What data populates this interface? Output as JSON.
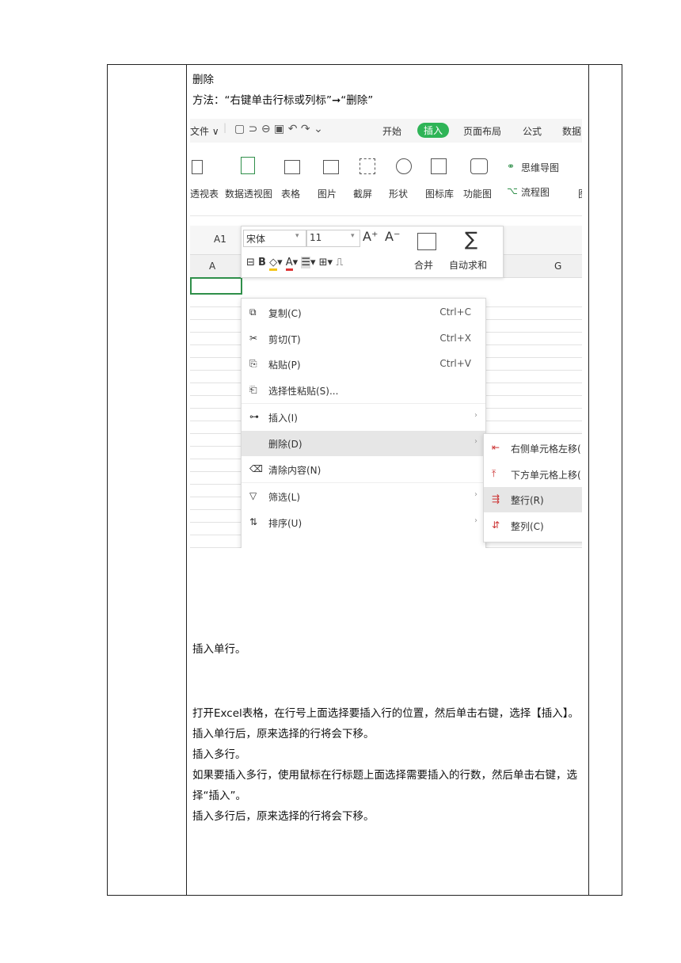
{
  "doc": {
    "heading": "删除",
    "method": "方法：“右键单击行标或列标”➞“删除”",
    "p1": "插入单行。",
    "p2": "打开Excel表格，在行号上面选择要插入行的位置，然后单击右键，选择【插入】。",
    "p3": "插入单行后，原来选择的行将会下移。",
    "p4": "插入多行。",
    "p5": "如果要插入多行，使用鼠标在行标题上面选择需要插入的行数，然后单击右键，选择“插入”。",
    "p6": "插入多行后，原来选择的行将会下移。"
  },
  "ribbon": {
    "tabs": [
      "文件 ∨",
      "开始",
      "插入",
      "页面布局",
      "公式",
      "数据"
    ],
    "active_tab": "插入",
    "buttons": [
      "透视表",
      "数据透视图",
      "表格",
      "图片",
      "截屏",
      "形状",
      "图标库",
      "功能图"
    ],
    "mindmap": "思维导图",
    "flowchart": "流程图",
    "extra_cut": "图"
  },
  "sheet": {
    "cell_ref": "A1",
    "col_a": "A",
    "col_g": "G"
  },
  "format_toolbar": {
    "font": "宋体",
    "size": "11",
    "grow": "A⁺",
    "shrink": "A⁻",
    "merge": "合并",
    "autosum": "自动求和"
  },
  "context_menu": {
    "items": [
      {
        "label": "复制(C)",
        "shortcut": "Ctrl+C"
      },
      {
        "label": "剪切(T)",
        "shortcut": "Ctrl+X"
      },
      {
        "label": "粘贴(P)",
        "shortcut": "Ctrl+V"
      },
      {
        "label": "选择性粘贴(S)...",
        "shortcut": ""
      },
      {
        "label": "插入(I)",
        "shortcut": ""
      },
      {
        "label": "删除(D)",
        "shortcut": ""
      },
      {
        "label": "清除内容(N)",
        "shortcut": ""
      },
      {
        "label": "筛选(L)",
        "shortcut": ""
      },
      {
        "label": "排序(U)",
        "shortcut": ""
      }
    ],
    "highlighted": "删除(D)"
  },
  "submenu": {
    "items": [
      "右侧单元格左移(",
      "下方单元格上移(",
      "整行(R)",
      "整列(C)"
    ],
    "highlighted": "整行(R)"
  },
  "colors": {
    "accent_green": "#2fb457",
    "menu_highlight": "#e6e6e6",
    "red_icon": "#d33333"
  }
}
